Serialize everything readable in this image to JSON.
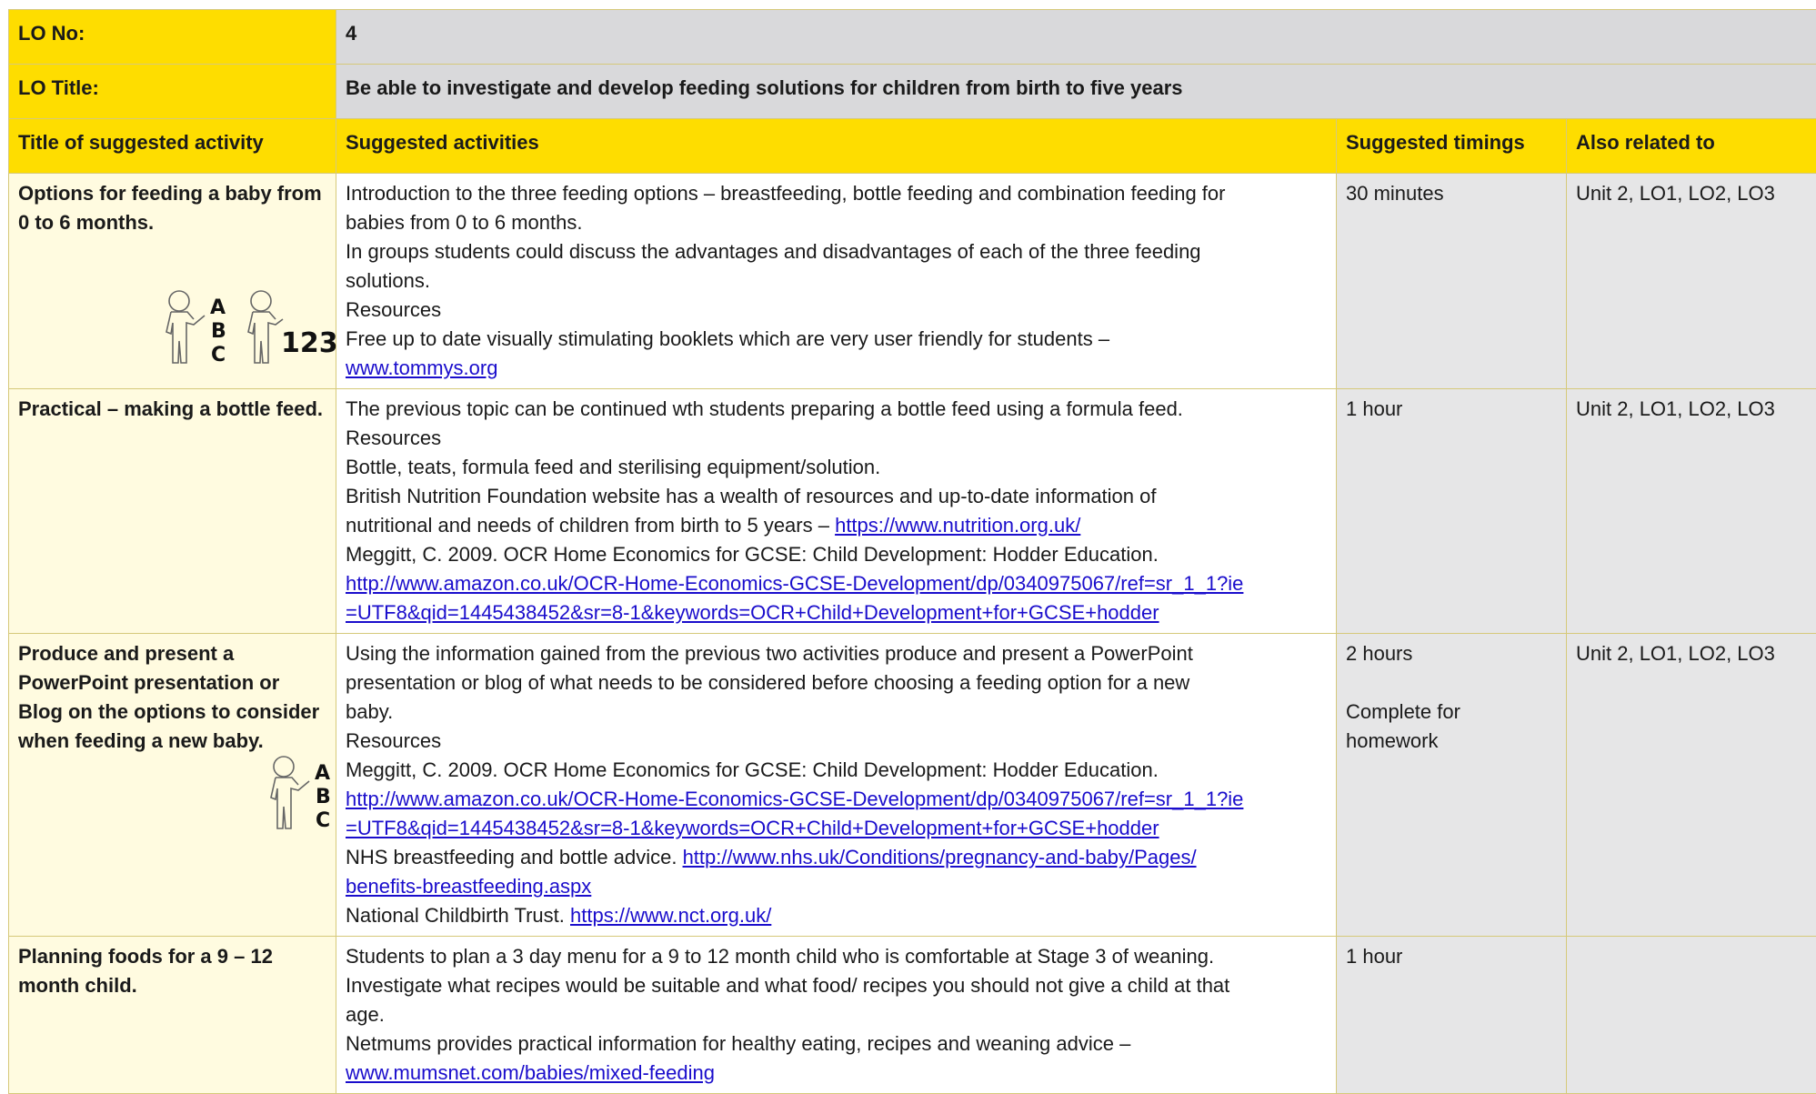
{
  "header": {
    "lo_no_label": "LO No:",
    "lo_no_value": "4",
    "lo_title_label": "LO Title:",
    "lo_title_value": "Be able to investigate and develop feeding solutions for children from birth to five years"
  },
  "columns": {
    "title": "Title of suggested activity",
    "activities": "Suggested activities",
    "timings": "Suggested timings",
    "related": "Also related to"
  },
  "rows": [
    {
      "title": "Options for feeding a baby from 0 to 6 months.",
      "lines": [
        "Introduction to the three feeding options – breastfeeding, bottle feeding and combination feeding for",
        "babies from 0 to 6 months.",
        "In groups students could discuss the advantages and disadvantages of each of the three feeding",
        "solutions.",
        "Resources",
        "Free up to date visually stimulating booklets which are very user friendly for students –"
      ],
      "link1": "www.tommys.org",
      "timing": "30 minutes",
      "related": "Unit 2, LO1, LO2, LO3",
      "icon_text": "123"
    },
    {
      "title": "Practical – making a bottle feed.",
      "line1": "The previous topic can be continued wth students preparing a bottle feed using a formula feed.",
      "line2": "Resources",
      "line3": "Bottle, teats, formula feed and sterilising equipment/solution.",
      "line4": "British Nutrition Foundation website has a wealth of resources and up-to-date information of",
      "line5_text": "nutritional and needs of children from birth to 5 years – ",
      "line5_link": "https://www.nutrition.org.uk/",
      "line6": "Meggitt, C. 2009. OCR Home Economics for GCSE: Child Development: Hodder Education.",
      "link_a": "http://www.amazon.co.uk/OCR-Home-Economics-GCSE-Development/dp/0340975067/ref=sr_1_1?ie",
      "link_b": "=UTF8&qid=1445438452&sr=8-1&keywords=OCR+Child+Development+for+GCSE+hodder",
      "timing": "1 hour",
      "related": "Unit 2, LO1, LO2, LO3"
    },
    {
      "title": "Produce and present a PowerPoint presentation or Blog on the options to consider when feeding a new baby.",
      "line1": "Using the information gained from the previous two activities produce and present a PowerPoint",
      "line2": "presentation or blog of what needs to be considered before choosing a feeding option for a new",
      "line3": "baby.",
      "line4": "Resources",
      "line5": "Meggitt, C. 2009. OCR Home Economics for GCSE: Child Development: Hodder Education.",
      "link_a": "http://www.amazon.co.uk/OCR-Home-Economics-GCSE-Development/dp/0340975067/ref=sr_1_1?ie",
      "link_b": "=UTF8&qid=1445438452&sr=8-1&keywords=OCR+Child+Development+for+GCSE+hodder",
      "nhs_text": "NHS breastfeeding and bottle advice. ",
      "nhs_link_a": "http://www.nhs.uk/Conditions/pregnancy-and-baby/Pages/",
      "nhs_link_b": "benefits-breastfeeding.aspx",
      "nct_text": "National Childbirth Trust. ",
      "nct_link": "https://www.nct.org.uk/",
      "timing": "2 hours",
      "timing2": "Complete for homework",
      "related": "Unit 2, LO1, LO2, LO3"
    },
    {
      "title": "Planning foods for a 9 – 12 month child.",
      "line1": "Students to plan a 3 day menu for a 9 to 12 month child who is comfortable at Stage 3 of weaning.",
      "line2": "Investigate what recipes would be suitable and what food/ recipes you should not give a child at that",
      "line3": "age.",
      "line4": "Netmums provides practical information for healthy eating, recipes and weaning advice –",
      "link": "www.mumsnet.com/babies/mixed-feeding",
      "timing": "1 hour",
      "related": ""
    }
  ],
  "icons": {
    "abc_letters": [
      "A",
      "B",
      "C"
    ]
  }
}
